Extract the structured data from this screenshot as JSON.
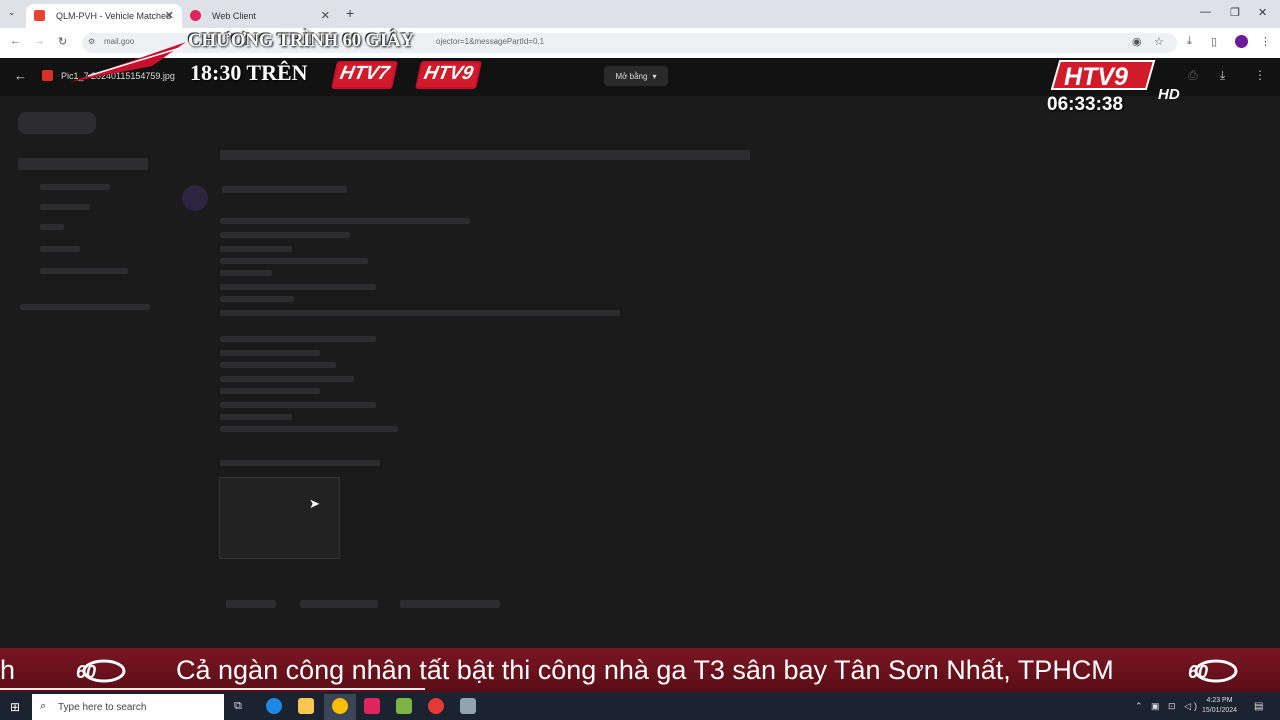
{
  "browser": {
    "tabs": [
      {
        "label": "QLM-PVH - Vehicle Matched"
      },
      {
        "label": "Web Client"
      }
    ],
    "new_tab": "+",
    "url_start": "mail.goo",
    "url_end": "ojector=1&messagePartId=0.1"
  },
  "viewer": {
    "filename": "Pic1_7  20240115154759.jpg",
    "open_with": "Mở bằng"
  },
  "overlay": {
    "promo_line1": "CHƯƠNG TRÌNH 60 GIÂY",
    "promo_line2": "18:30 TRÊN",
    "channel_a": "HTV7",
    "channel_b": "HTV9",
    "logo_text": "HTV9",
    "logo_hd": "HD",
    "clock": "06:33:38"
  },
  "ticker": {
    "lead": "h",
    "headline": "Cả ngàn công nhân tất bật thi công nhà ga T3 sân bay Tân Sơn Nhất, TPHCM",
    "logo": "60"
  },
  "taskbar": {
    "search_placeholder": "Type here to search",
    "time": "4:23 PM",
    "date": "15/01/2024"
  },
  "colors": {
    "ticker_bg": "#7a1622",
    "channel_red": "#d11a2a",
    "tab_strip": "#dee1e6"
  }
}
